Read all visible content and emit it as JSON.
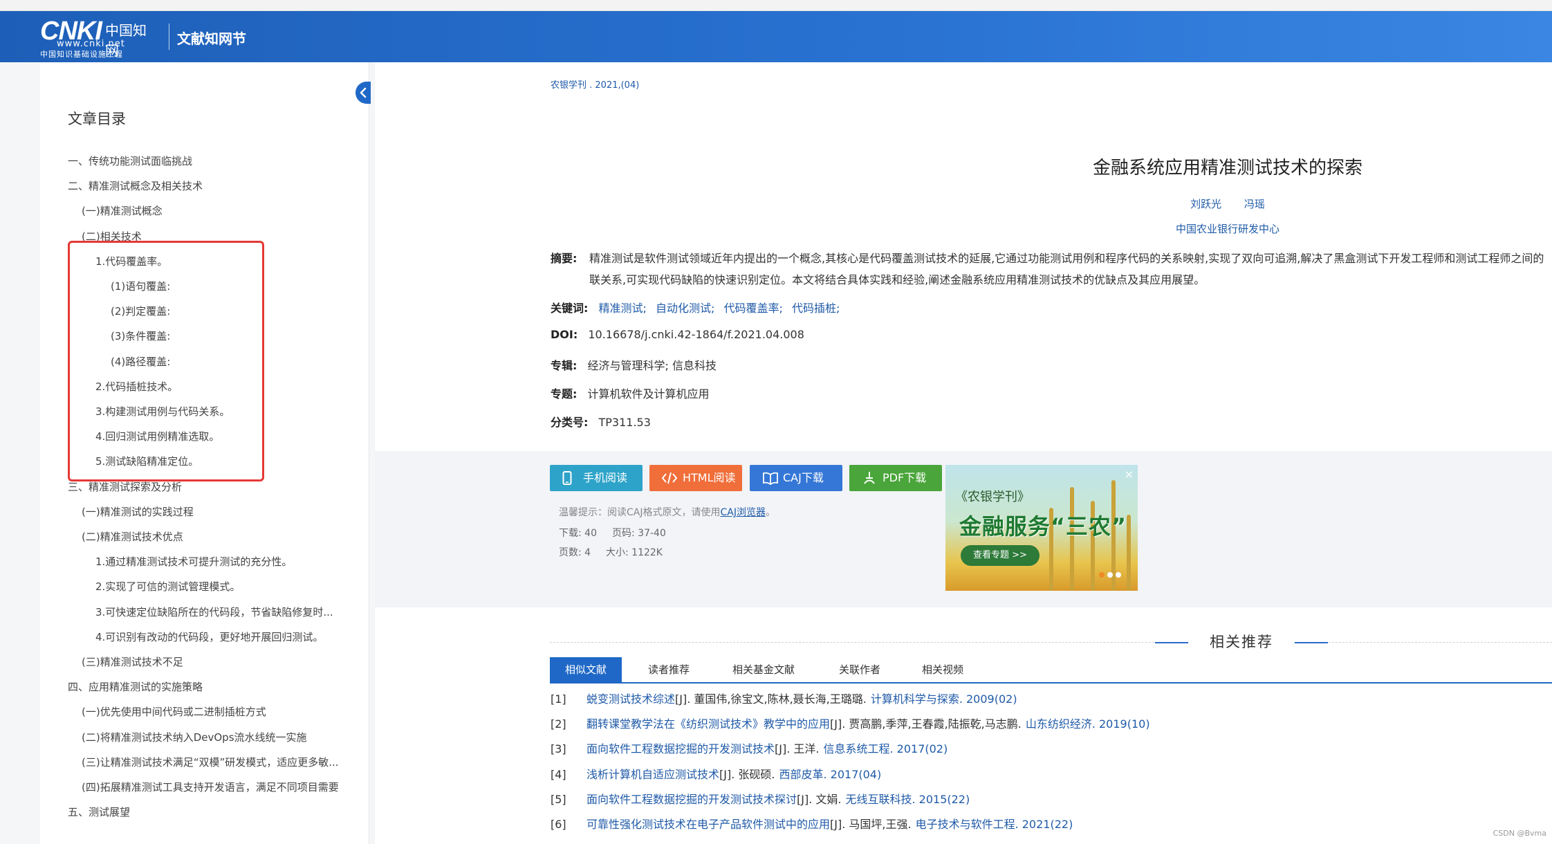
{
  "header": {
    "logo_main": "CNKI",
    "logo_cn": "中国知网",
    "logo_url": "www.cnki.net",
    "logo_sub": "中国知识基础设施工程",
    "title": "文献知网节"
  },
  "sidebar": {
    "title": "文章目录",
    "items": [
      {
        "label": "一、传统功能测试面临挑战",
        "level": 0
      },
      {
        "label": "二、精准测试概念及相关技术",
        "level": 0
      },
      {
        "label": "(一)精准测试概念",
        "level": 1
      },
      {
        "label": "(二)相关技术",
        "level": 1
      },
      {
        "label": "1.代码覆盖率。",
        "level": 2
      },
      {
        "label": "(1)语句覆盖:",
        "level": 3
      },
      {
        "label": "(2)判定覆盖:",
        "level": 3
      },
      {
        "label": "(3)条件覆盖:",
        "level": 3
      },
      {
        "label": "(4)路径覆盖:",
        "level": 3
      },
      {
        "label": "2.代码插桩技术。",
        "level": 2
      },
      {
        "label": "3.构建测试用例与代码关系。",
        "level": 2
      },
      {
        "label": "4.回归测试用例精准选取。",
        "level": 2
      },
      {
        "label": "5.测试缺陷精准定位。",
        "level": 2
      },
      {
        "label": "三、精准测试探索及分析",
        "level": 0
      },
      {
        "label": "(一)精准测试的实践过程",
        "level": 1
      },
      {
        "label": "(二)精准测试技术优点",
        "level": 1
      },
      {
        "label": "1.通过精准测试技术可提升测试的充分性。",
        "level": 2
      },
      {
        "label": "2.实现了可信的测试管理模式。",
        "level": 2
      },
      {
        "label": "3.可快速定位缺陷所在的代码段，节省缺陷修复时...",
        "level": 2
      },
      {
        "label": "4.可识别有改动的代码段，更好地开展回归测试。",
        "level": 2
      },
      {
        "label": "(三)精准测试技术不足",
        "level": 1
      },
      {
        "label": "四、应用精准测试的实施策略",
        "level": 0
      },
      {
        "label": "(一)优先使用中间代码或二进制插桩方式",
        "level": 1
      },
      {
        "label": "(二)将精准测试技术纳入DevOps流水线统一实施",
        "level": 1
      },
      {
        "label": "(三)让精准测试技术满足“双模”研发模式，适应更多敏...",
        "level": 1
      },
      {
        "label": "(四)拓展精准测试工具支持开发语言，满足不同项目需要",
        "level": 1
      },
      {
        "label": "五、测试展望",
        "level": 0
      }
    ]
  },
  "article": {
    "source": "农银学刊 . 2021,(04)",
    "title": "金融系统应用精准测试技术的探索",
    "authors": [
      "刘跃光",
      "冯瑶"
    ],
    "org": "中国农业银行研发中心",
    "abstract_label": "摘要:",
    "abstract_line1": "精准测试是软件测试领域近年内提出的一个概念,其核心是代码覆盖测试技术的延展,它通过功能测试用例和程序代码的关系映射,实现了双向可追溯,解决了黑盒测试下开发工程师和测试工程师之间的",
    "abstract_line2": "联关系,可实现代码缺陷的快速识别定位。本文将结合具体实践和经验,阐述金融系统应用精准测试技术的优缺点及其应用展望。",
    "keywords_label": "关键词:",
    "keywords": [
      "精准测试;",
      "自动化测试;",
      "代码覆盖率;",
      "代码插桩;"
    ],
    "doi_label": "DOI:",
    "doi": "10.16678/j.cnki.42-1864/f.2021.04.008",
    "series_label": "专辑:",
    "series": "经济与管理科学; 信息科技",
    "topic_label": "专题:",
    "topic": "计算机软件及计算机应用",
    "class_label": "分类号:",
    "class": "TP311.53"
  },
  "download": {
    "btn_mobile": "手机阅读",
    "btn_html": "HTML阅读",
    "btn_caj": "CAJ下载",
    "btn_pdf": "PDF下载",
    "tip": "温馨提示：阅读CAJ格式原文，请使用",
    "tip_link": "CAJ浏览器",
    "tip_end": "。",
    "downloads_label": "下载:",
    "downloads": "40",
    "pages_range_label": "页码:",
    "pages_range": "37-40",
    "pages_label": "页数:",
    "pages": "4",
    "size_label": "大小:",
    "size": "1122K"
  },
  "ad": {
    "line1": "《农银学刊》",
    "line2": "金融服务“三农”",
    "button": "查看专题 >>",
    "close": "×"
  },
  "related": {
    "title": "相关推荐",
    "tabs": [
      "相似文献",
      "读者推荐",
      "相关基金文献",
      "关联作者",
      "相关视频"
    ],
    "items": [
      {
        "idx": "[1]",
        "title": "蜕变测试技术综述",
        "authors": "[J]. 董国伟,徐宝文,陈林,聂长海,王璐璐.",
        "journal": "计算机科学与探索. 2009(02)"
      },
      {
        "idx": "[2]",
        "title": "翻转课堂教学法在《纺织测试技术》教学中的应用",
        "authors": "[J]. 贾高鹏,季萍,王春霞,陆振乾,马志鹏.",
        "journal": "山东纺织经济. 2019(10)"
      },
      {
        "idx": "[3]",
        "title": "面向软件工程数据挖掘的开发测试技术",
        "authors": "[J]. 王洋.",
        "journal": "信息系统工程. 2017(02)"
      },
      {
        "idx": "[4]",
        "title": "浅析计算机自适应测试技术",
        "authors": "[J]. 张砚硕.",
        "journal": "西部皮革. 2017(04)"
      },
      {
        "idx": "[5]",
        "title": "面向软件工程数据挖掘的开发测试技术探讨",
        "authors": "[J]. 文娟.",
        "journal": "无线互联科技. 2015(22)"
      },
      {
        "idx": "[6]",
        "title": "可靠性强化测试技术在电子产品软件测试中的应用",
        "authors": "[J]. 马国坪,王强.",
        "journal": "电子技术与软件工程. 2021(22)"
      }
    ]
  },
  "watermark": "CSDN @Bvma"
}
